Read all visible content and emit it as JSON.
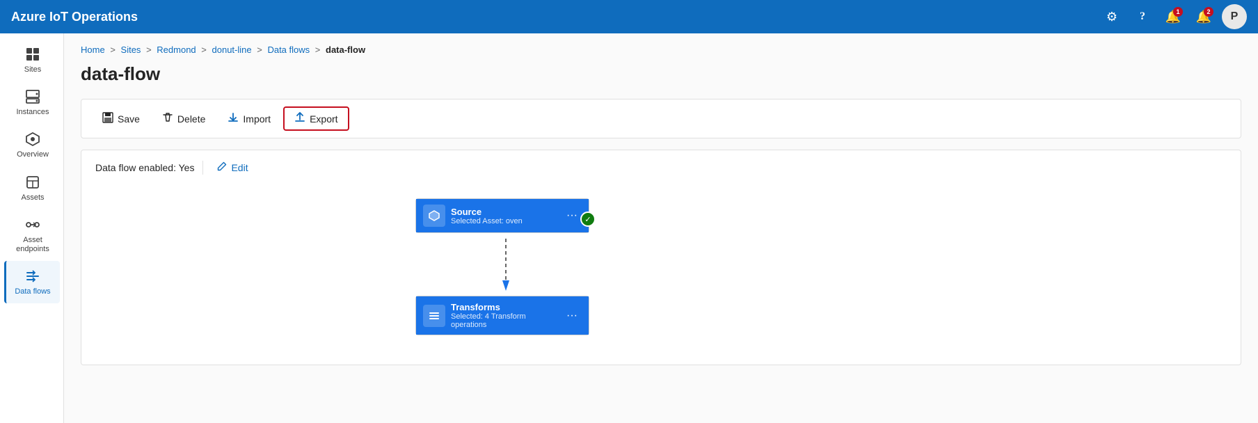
{
  "app": {
    "title": "Azure IoT Operations"
  },
  "header": {
    "title": "Azure IoT Operations",
    "icons": {
      "gear": "⚙",
      "help": "?",
      "notification1_label": "Notifications",
      "notification1_count": "1",
      "notification2_label": "Alerts",
      "notification2_count": "2",
      "avatar_label": "P"
    }
  },
  "sidebar": {
    "items": [
      {
        "id": "sites",
        "label": "Sites",
        "active": false
      },
      {
        "id": "instances",
        "label": "Instances",
        "active": false
      },
      {
        "id": "overview",
        "label": "Overview",
        "active": false
      },
      {
        "id": "assets",
        "label": "Assets",
        "active": false
      },
      {
        "id": "asset-endpoints",
        "label": "Asset endpoints",
        "active": false
      },
      {
        "id": "data-flows",
        "label": "Data flows",
        "active": true
      }
    ]
  },
  "breadcrumb": {
    "parts": [
      "Home",
      "Sites",
      "Redmond",
      "donut-line",
      "Data flows"
    ],
    "current": "data-flow"
  },
  "page": {
    "title": "data-flow"
  },
  "toolbar": {
    "save_label": "Save",
    "delete_label": "Delete",
    "import_label": "Import",
    "export_label": "Export"
  },
  "info": {
    "enabled_label": "Data flow enabled: Yes",
    "edit_label": "Edit"
  },
  "flow": {
    "source_node": {
      "title": "Source",
      "subtitle": "Selected Asset: oven",
      "status": "ok"
    },
    "transform_node": {
      "title": "Transforms",
      "subtitle": "Selected: 4 Transform operations"
    }
  }
}
